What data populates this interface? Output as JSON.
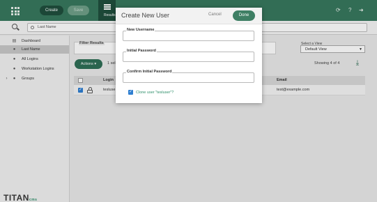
{
  "topbar": {
    "create_label": "Create",
    "save_label": "Save",
    "results_label": "Results"
  },
  "search": {
    "value": "Last Name"
  },
  "sidebar": {
    "items": [
      {
        "label": "Dashboard",
        "icon": "dashboard-icon"
      },
      {
        "label": "Last Name",
        "icon": "person-icon"
      },
      {
        "label": "All Logins",
        "icon": "person-icon"
      },
      {
        "label": "Workstation Logins",
        "icon": "person-icon"
      },
      {
        "label": "Groups",
        "icon": "people-icon"
      }
    ],
    "brand": "TITAN",
    "brand_suffix": "cms"
  },
  "main": {
    "filter_label": "Filter Results",
    "view_label": "Select a View",
    "view_value": "Default View",
    "actions_label": "Actions",
    "selected_count": "1 sel",
    "showing": "Showing 4 of 4",
    "table": {
      "headers": [
        "Login",
        "Email"
      ],
      "row": {
        "login": "tesluse",
        "email": "test@example.com"
      }
    }
  },
  "modal": {
    "title": "Create New User",
    "cancel_label": "Cancel",
    "done_label": "Done",
    "fields": [
      {
        "label": "New Username",
        "value": ""
      },
      {
        "label": "Initial Password",
        "value": ""
      },
      {
        "label": "Confirm Initial Password",
        "value": ""
      }
    ],
    "clone_label": "Clone user \"tesluser\"?",
    "clone_checked": true
  },
  "colors": {
    "topbar": "#38785e",
    "accent": "#2f6e56",
    "checkbox": "#2f7fd1",
    "link_green": "#2e8f6a"
  }
}
